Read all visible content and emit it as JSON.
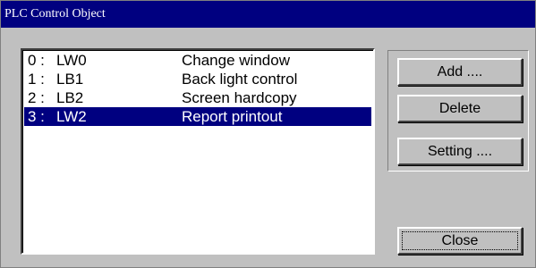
{
  "window": {
    "title": "PLC Control Object"
  },
  "list": {
    "items": [
      {
        "index": "0 :",
        "address": "LW0",
        "name": "Change window",
        "selected": false
      },
      {
        "index": "1 :",
        "address": "LB1",
        "name": "Back light control",
        "selected": false
      },
      {
        "index": "2 :",
        "address": "LB2",
        "name": "Screen hardcopy",
        "selected": false
      },
      {
        "index": "3 :",
        "address": "LW2",
        "name": "Report printout",
        "selected": true
      }
    ],
    "selected_bg": "#000080",
    "selected_fg": "#ffffff"
  },
  "buttons": {
    "add_label": "Add ....",
    "delete_label": "Delete",
    "setting_label": "Setting ....",
    "close_label": "Close"
  },
  "colors": {
    "title_bar": "#000080",
    "window_bg": "#c0c0c0"
  }
}
